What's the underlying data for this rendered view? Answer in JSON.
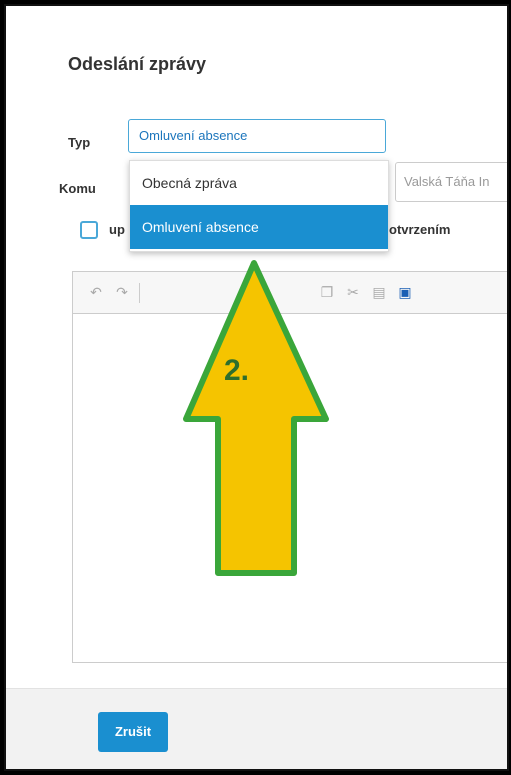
{
  "dialog": {
    "title": "Odeslání zprávy",
    "type_label": "Typ",
    "recipient_label": "Komu",
    "type_value": "Omluvení absence",
    "recipient_value": "Valská Táňa In",
    "checkbox_label_start": "up",
    "checkbox_label_end": "otvrzením",
    "cancel_label": "Zrušit"
  },
  "dropdown": {
    "options": [
      "Obecná zpráva",
      "Omluvení absence"
    ],
    "selected_index": 1
  },
  "annotation": {
    "step_label": "2.",
    "arrow_color": "#f5c400",
    "arrow_border_color": "#3aa63a"
  },
  "colors": {
    "accent": "#1a8fd0"
  }
}
